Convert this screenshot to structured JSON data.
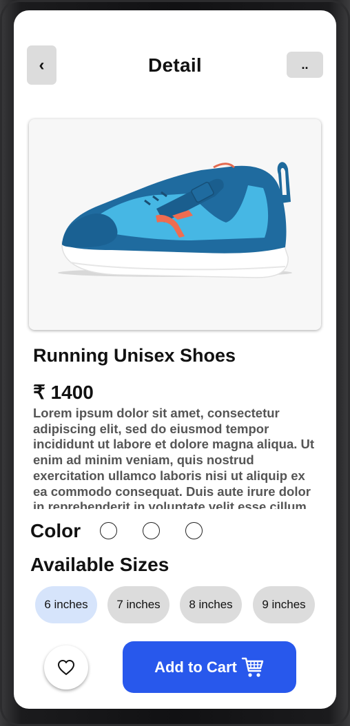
{
  "header": {
    "back_icon": "‹",
    "title": "Detail",
    "more_label": ".."
  },
  "product": {
    "image": "blue-running-shoe",
    "name": "Running Unisex Shoes",
    "price": "₹ 1400",
    "description": "Lorem ipsum dolor sit amet, consectetur adipiscing elit, sed do eiusmod tempor incididunt ut labore et dolore magna aliqua. Ut enim ad minim veniam, quis nostrud exercitation ullamco laboris nisi ut aliquip ex ea commodo consequat. Duis aute irure dolor in reprehenderit in voluptate velit esse cillum dolore eu fugiat nulla pariatur."
  },
  "color": {
    "label": "Color",
    "swatches": [
      "#ffffff",
      "#ffffff",
      "#ffffff"
    ]
  },
  "sizes": {
    "label": "Available Sizes",
    "options": [
      "6 inches",
      "7 inches",
      "8 inches",
      "9 inches"
    ],
    "selected": "6 inches"
  },
  "actions": {
    "favorite_icon": "heart-icon",
    "add_to_cart_label": "Add to Cart",
    "cart_icon": "cart-icon"
  },
  "colors": {
    "accent": "#2858ec",
    "chip": "#dcdcdc",
    "chip_selected": "#d6e4fb"
  }
}
